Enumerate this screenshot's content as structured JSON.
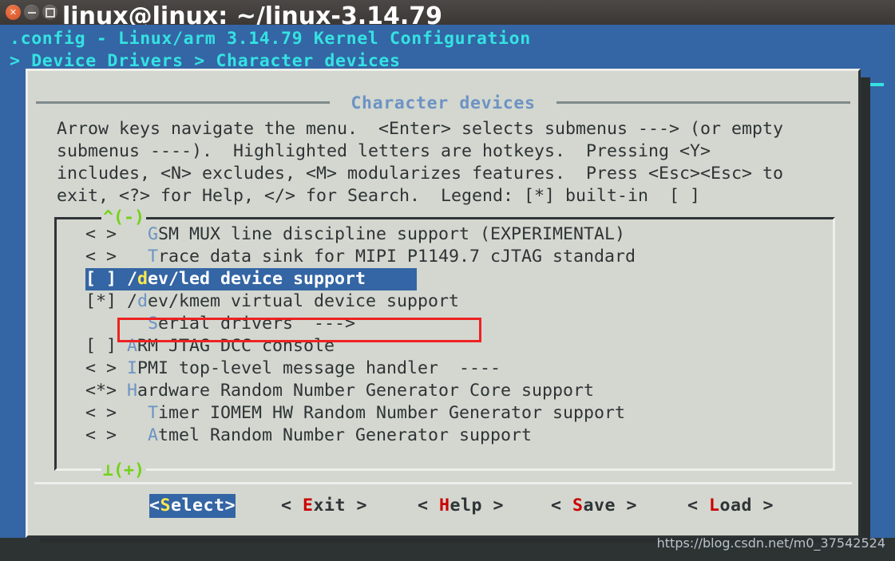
{
  "window": {
    "title": "linux@linux: ~/linux-3.14.79",
    "controls": {
      "close": "close-button",
      "minimize": "minimize-button",
      "maximize": "maximize-button"
    }
  },
  "header": {
    "title": ".config - Linux/arm 3.14.79 Kernel Configuration",
    "breadcrumb": "> Device Drivers > Character devices"
  },
  "dialog": {
    "title": "Character devices",
    "help_text": "Arrow keys navigate the menu.  <Enter> selects submenus ---> (or empty\nsubmenus ----).  Highlighted letters are hotkeys.  Pressing <Y>\nincludes, <N> excludes, <M> modularizes features.  Press <Esc><Esc> to\nexit, <?> for Help, </> for Search.  Legend: [*] built-in  [ ]"
  },
  "list": {
    "scroll_up_marker": "^(-)",
    "scroll_down_marker": "⊥(+)",
    "items": [
      {
        "state": "< >",
        "indent": "   ",
        "hotkey": "G",
        "label": "SM MUX line discipline support (EXPERIMENTAL)",
        "selected": false
      },
      {
        "state": "< >",
        "indent": "   ",
        "hotkey": "T",
        "label": "race data sink for MIPI P1149.7 cJTAG standard",
        "selected": false
      },
      {
        "state": "[ ]",
        "indent": " ",
        "prefix": "/",
        "hotkey": "d",
        "label": "ev/led device support",
        "selected": true
      },
      {
        "state": "[*]",
        "indent": " ",
        "prefix": "/",
        "hotkey": "d",
        "label": "ev/kmem virtual device support",
        "selected": false
      },
      {
        "state": "   ",
        "indent": "   ",
        "hotkey": "S",
        "label": "erial drivers  --->",
        "selected": false
      },
      {
        "state": "[ ]",
        "indent": " ",
        "hotkey": "A",
        "label": "RM JTAG DCC console",
        "selected": false
      },
      {
        "state": "< >",
        "indent": " ",
        "hotkey": "I",
        "label": "PMI top-level message handler  ----",
        "selected": false
      },
      {
        "state": "<*>",
        "indent": " ",
        "hotkey": "H",
        "label": "ardware Random Number Generator Core support",
        "selected": false
      },
      {
        "state": "< >",
        "indent": "   ",
        "hotkey": "T",
        "label": "imer IOMEM HW Random Number Generator support",
        "selected": false
      },
      {
        "state": "< >",
        "indent": "   ",
        "hotkey": "A",
        "label": "tmel Random Number Generator support",
        "selected": false
      }
    ]
  },
  "buttons": [
    {
      "name": "select",
      "left": "<",
      "hotkey": "S",
      "rest": "elect",
      "right": ">",
      "active": true
    },
    {
      "name": "exit",
      "left": "< ",
      "hotkey": "E",
      "rest": "xit",
      "right": " >",
      "active": false
    },
    {
      "name": "help",
      "left": "< ",
      "hotkey": "H",
      "rest": "elp",
      "right": " >",
      "active": false
    },
    {
      "name": "save",
      "left": "< ",
      "hotkey": "S",
      "rest": "ave",
      "right": " >",
      "active": false
    },
    {
      "name": "load",
      "left": "< ",
      "hotkey": "L",
      "rest": "oad",
      "right": " >",
      "active": false
    }
  ],
  "watermark": "https://blog.csdn.net/m0_37542524",
  "colors": {
    "menu_background": "#3465a4",
    "dialog_background": "#d3d7cf",
    "header_cyan": "#34e2e2",
    "hotkey_blue": "#6d93c4",
    "hotkey_yellow": "#fce94f",
    "hotkey_red": "#cc0000",
    "scroll_green": "#73d216",
    "annotation_red": "#ee2222",
    "terminal_background": "#2d3232"
  }
}
